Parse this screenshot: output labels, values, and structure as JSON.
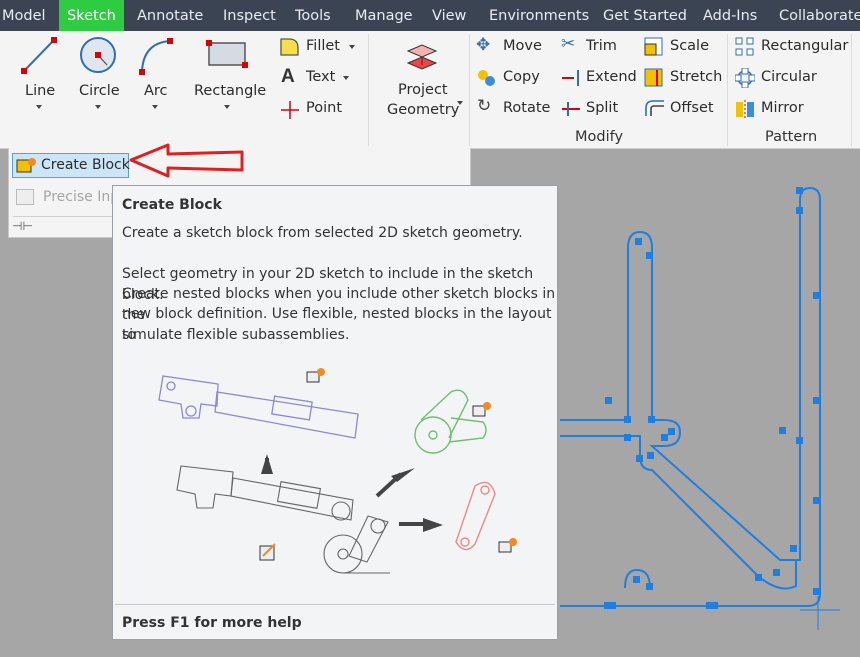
{
  "tabs": [
    "Model",
    "Sketch",
    "Annotate",
    "Inspect",
    "Tools",
    "Manage",
    "View",
    "Environments",
    "Get Started",
    "Add-Ins",
    "Collaborate"
  ],
  "create": {
    "line": "Line",
    "circle": "Circle",
    "arc": "Arc",
    "rectangle": "Rectangle",
    "fillet": "Fillet",
    "text": "Text",
    "point": "Point"
  },
  "project": {
    "line1": "Project",
    "line2": "Geometry"
  },
  "modify": {
    "move": "Move",
    "copy": "Copy",
    "rotate": "Rotate",
    "trim": "Trim",
    "extend": "Extend",
    "split": "Split",
    "scale": "Scale",
    "stretch": "Stretch",
    "offset": "Offset",
    "group": "Modify"
  },
  "pattern": {
    "rectangular": "Rectangular",
    "circular": "Circular",
    "mirror": "Mirror",
    "group": "Pattern"
  },
  "panel": {
    "create_block": "Create Block",
    "precise_input": "Precise Inp"
  },
  "tooltip": {
    "title": "Create Block",
    "summary": "Create a sketch block from selected 2D sketch geometry.",
    "lines": [
      "Select geometry in your 2D sketch to include in the sketch block.",
      "Create nested blocks when you include other sketch blocks in the",
      "new block definition. Use flexible, nested blocks in the layout to",
      "simulate flexible subassemblies."
    ],
    "footer": "Press F1 for more help"
  },
  "colors": {
    "tabbar": "#3b4453",
    "active_tab": "#2ecc40",
    "ribbon": "#f4f4f4",
    "canvas": "#a6a6a6",
    "sketch": "#1e7fe0",
    "arrow": "#e02020"
  }
}
